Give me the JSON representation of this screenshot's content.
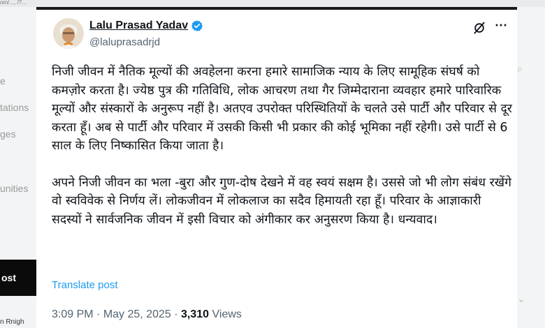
{
  "browser": {
    "address_fragment": "om/..., /?..."
  },
  "sidebar": {
    "fragments": [
      "e",
      "tations",
      "ges",
      "unities"
    ],
    "post_label": "ost",
    "bottom_fragment": "n Rnigh"
  },
  "author": {
    "name": "Lalu Prasad Yadav",
    "handle": "@laluprasadrjd",
    "verified_color": "#1d9bf0"
  },
  "tweet": {
    "paragraphs": [
      "निजी जीवन में नैतिक मूल्यों की अवहेलना करना हमारे सामाजिक न्याय के लिए सामूहिक संघर्ष को कमज़ोर करता है। ज्येष्ठ पुत्र की गतिविधि, लोक आचरण तथा गैर जिम्मेदाराना व्यवहार हमारे पारिवारिक मूल्यों और संस्कारों के अनुरूप नहीं है। अतएव उपरोक्त परिस्थितियों के चलते उसे पार्टी और परिवार से दूर करता हूँ। अब से पार्टी और परिवार में उसकी किसी भी प्रकार की कोई भूमिका नहीं रहेगी। उसे पार्टी से 6 साल के लिए निष्कासित किया जाता है।",
      "अपने निजी जीवन का भला -बुरा और गुण-दोष देखने में वह स्वयं सक्षम है। उससे जो भी लोग संबंध रखेंगे वो स्वविवेक से निर्णय लें। लोकजीवन में लोकलाज का सदैव हिमायती रहा हूँ। परिवार के आज्ञाकारी सदस्यों ने सार्वजनिक जीवन में इसी विचार को अंगीकार कर अनुसरण किया है। धन्यवाद।"
    ],
    "translate_label": "Translate post",
    "time": "3:09 PM",
    "separator": "·",
    "date": "May 25, 2025",
    "views_count": "3,310",
    "views_label": "Views"
  },
  "icons": {
    "grok": "grok-icon",
    "more": "more-icon",
    "verified": "verified-badge-icon"
  }
}
